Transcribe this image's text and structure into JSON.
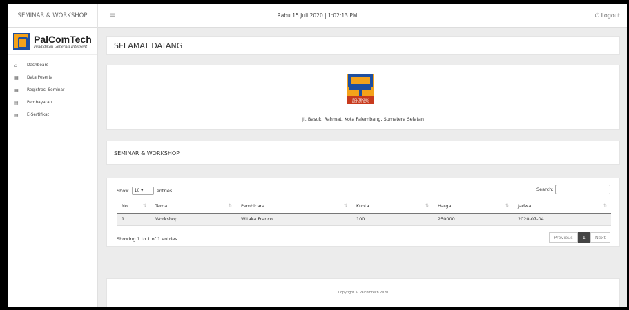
{
  "header": {
    "brand": "SEMINAR & WORKSHOP",
    "menu_icon": "hamburger-icon",
    "datetime": "Rabu 15 Juli 2020 | 1:02:13 PM",
    "logout": "Logout",
    "logout_icon": "power-icon"
  },
  "sidebar": {
    "logo_title": "PalComTech",
    "logo_subtitle": "Pendidikan Generasi Intersent",
    "items": [
      {
        "label": "Dashboard",
        "icon": "home-icon"
      },
      {
        "label": "Data Peserta",
        "icon": "users-icon"
      },
      {
        "label": "Registrasi Seminar",
        "icon": "register-icon"
      },
      {
        "label": "Pembayaran",
        "icon": "payment-icon"
      },
      {
        "label": "E-Sertifikat",
        "icon": "certificate-icon"
      }
    ]
  },
  "main": {
    "welcome": "SELAMAT DATANG",
    "address": "Jl. Basuki Rahmat, Kota Palembang, Sumatera Selatan",
    "logo_text": "POLITEKNIK PalComTech",
    "section_title": "SEMINAR & WORKSHOP",
    "table": {
      "show_label": "Show",
      "entries_label": "entries",
      "page_length": "10",
      "search_label": "Search:",
      "columns": [
        "No",
        "Tema",
        "Pembicara",
        "Kuota",
        "Harga",
        "Jadwal"
      ],
      "rows": [
        [
          "1",
          "Workshop",
          "Witaka Franco",
          "100",
          "250000",
          "2020-07-04"
        ]
      ],
      "info": "Showing 1 to 1 of 1 entries",
      "pagination": {
        "previous": "Previous",
        "current": "1",
        "next": "Next"
      }
    },
    "footer": "Copyright © Palcomtech 2020"
  },
  "colors": {
    "logo_orange": "#f4a21a",
    "logo_blue": "#1e4fa0",
    "active_page": "#444444"
  }
}
